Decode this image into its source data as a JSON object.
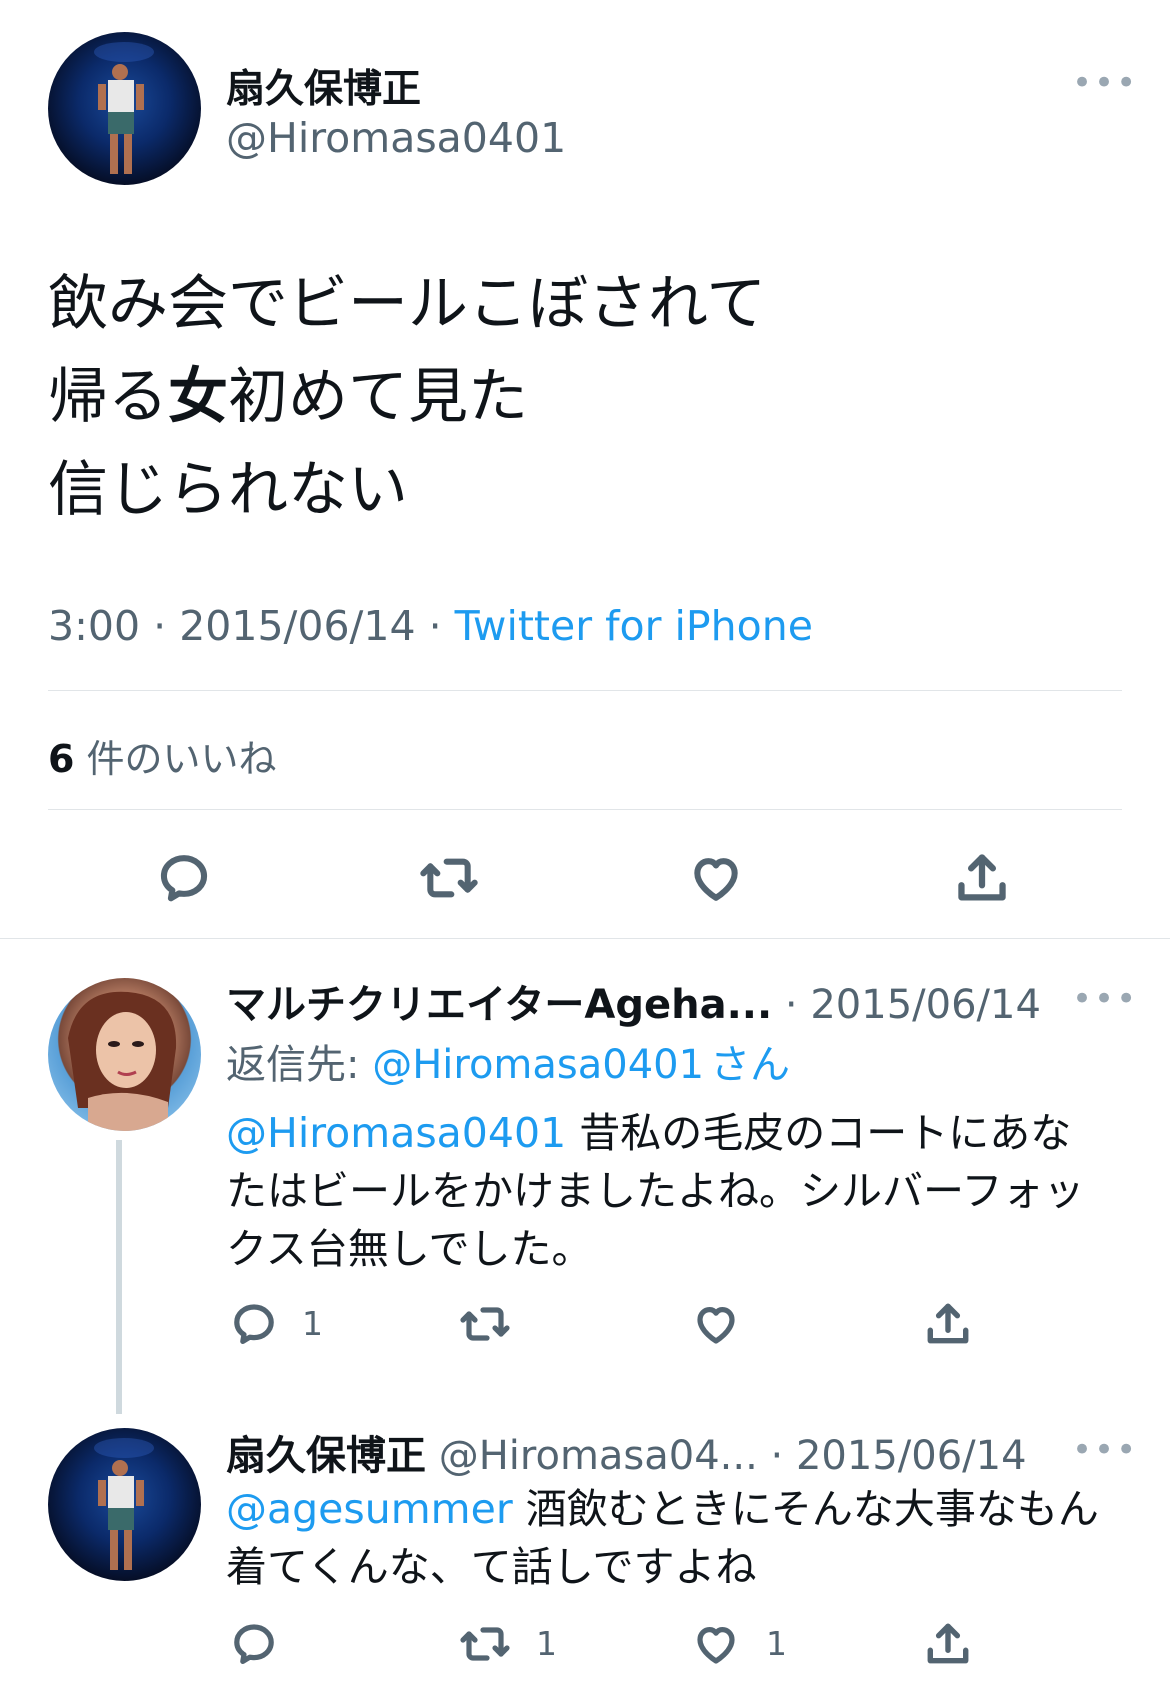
{
  "main_tweet": {
    "display_name": "扇久保博正",
    "handle": "@Hiromasa0401",
    "text_line1": "飲み会でビールこぼされて",
    "text_line2_a": "帰る",
    "text_line2_b": "女",
    "text_line2_c": "初めて見た",
    "text_line3": "信じられない",
    "time": "3:00",
    "sep1": "·",
    "date": "2015/06/14",
    "sep2": "·",
    "source": "Twitter for iPhone",
    "likes_count": "6",
    "likes_label": "件のいいね",
    "more": "•••"
  },
  "reply1": {
    "display_name": "マルチクリエイターAgeha...",
    "sep": "·",
    "date": "2015/06/14",
    "reply_to_label": "返信先: ",
    "reply_to_handle": "@Hiromasa0401",
    "reply_to_suffix": "さん",
    "mention": "@Hiromasa0401",
    "text_a": " 昔私の毛皮のコートにあな",
    "text_b": "たはビールをかけましたよね。シルバーフォッ",
    "text_c": "クス台無しでした。",
    "reply_count": "1",
    "more": "•••"
  },
  "reply2": {
    "display_name": "扇久保博正",
    "handle": "@Hiromasa04...",
    "sep": "·",
    "date": "2015/06/14",
    "mention": "@agesummer",
    "text_a": " 酒飲むときにそんな大事なもん",
    "text_b": "着てくんな、て話しですよね",
    "retweet_count": "1",
    "like_count": "1",
    "more": "•••"
  },
  "icons": {
    "reply": "reply-icon",
    "retweet": "retweet-icon",
    "like": "heart-icon",
    "share": "share-icon",
    "more": "more-icon"
  },
  "colors": {
    "link": "#1d9bf0",
    "muted": "#536471",
    "text": "#0f1419"
  }
}
